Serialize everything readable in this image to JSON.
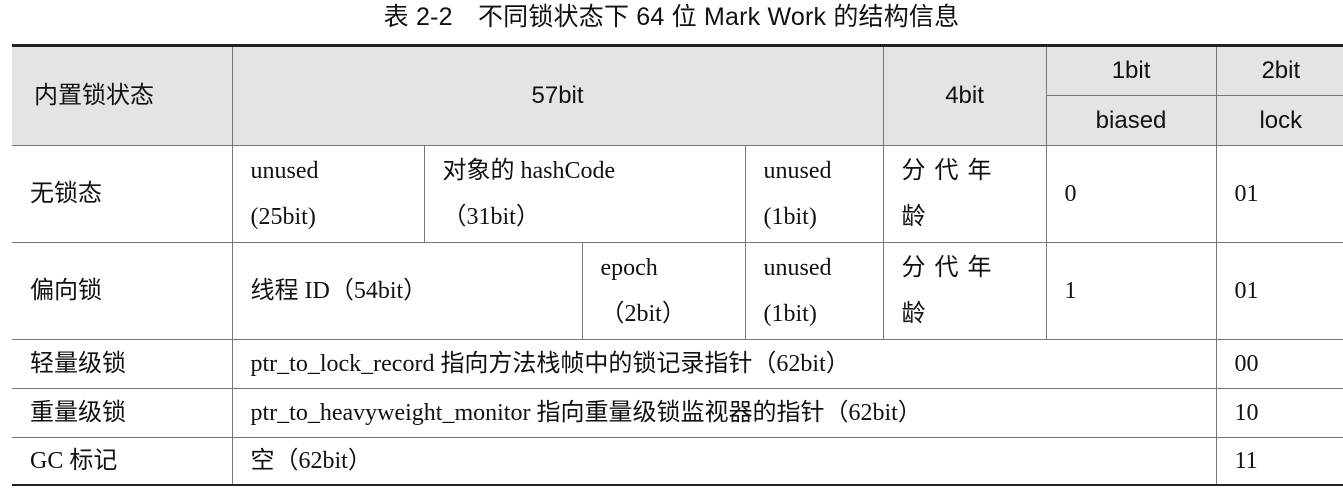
{
  "caption": "表 2-2　不同锁状态下 64 位 Mark Work 的结构信息",
  "header": {
    "state_label": "内置锁状态",
    "bits57": "57bit",
    "bits4": "4bit",
    "bit1": "1bit",
    "bit2": "2bit",
    "biased": "biased",
    "lock": "lock"
  },
  "rows": {
    "unlocked": {
      "state": "无锁态",
      "unused25_a": "unused",
      "unused25_b": "(25bit)",
      "hash_a": "对象的 hashCode",
      "hash_b": "（31bit）",
      "unused1_a": "unused",
      "unused1_b": "(1bit)",
      "age_a": "分代年",
      "age_b": "龄",
      "biased": "0",
      "lock": "01"
    },
    "biased": {
      "state": "偏向锁",
      "thread": "线程 ID（54bit）",
      "epoch_a": "epoch",
      "epoch_b": "（2bit）",
      "unused1_a": "unused",
      "unused1_b": "(1bit)",
      "age_a": "分代年",
      "age_b": "龄",
      "biased": "1",
      "lock": "01"
    },
    "lightweight": {
      "state": "轻量级锁",
      "content": "ptr_to_lock_record 指向方法栈帧中的锁记录指针（62bit）",
      "lock": "00"
    },
    "heavyweight": {
      "state": "重量级锁",
      "content": "ptr_to_heavyweight_monitor 指向重量级锁监视器的指针（62bit）",
      "lock": "10"
    },
    "gc": {
      "state": "GC 标记",
      "content": "空（62bit）",
      "lock": "11"
    }
  }
}
